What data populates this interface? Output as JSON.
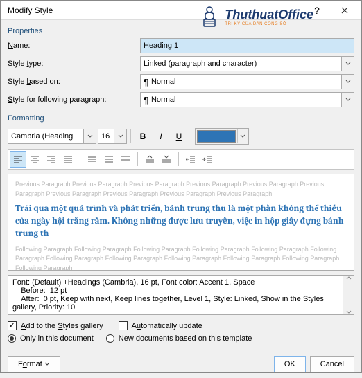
{
  "dialog": {
    "title": "Modify Style"
  },
  "sections": {
    "properties": "Properties",
    "formatting": "Formatting"
  },
  "props": {
    "name_label": "Name:",
    "name_value": "Heading 1",
    "type_label": "Style type:",
    "type_value": "Linked (paragraph and character)",
    "based_label": "Style based on:",
    "based_value": "Normal",
    "follow_label": "Style for following paragraph:",
    "follow_value": "Normal"
  },
  "font": {
    "family": "Cambria (Heading",
    "size": "16"
  },
  "preview": {
    "ghost_before": "Previous Paragraph Previous Paragraph Previous Paragraph Previous Paragraph Previous Paragraph Previous Paragraph Previous Paragraph Previous Paragraph Previous Paragraph Previous Paragraph",
    "sample": "Trải qua một quá trình và phát triển, bánh trung thu là một phần không thể thiếu của ngày hội trăng rằm. Không những được lưu truyền, việc in hộp giấy đựng bánh trung th",
    "ghost_after": "Following Paragraph Following Paragraph Following Paragraph Following Paragraph Following Paragraph Following Paragraph Following Paragraph Following Paragraph Following Paragraph Following Paragraph Following Paragraph Following Paragraph"
  },
  "desc": {
    "line1": "Font: (Default) +Headings (Cambria), 16 pt, Font color: Accent 1, Space",
    "line2": "    Before:  12 pt",
    "line3": "    After:  0 pt, Keep with next, Keep lines together, Level 1, Style: Linked, Show in the Styles gallery, Priority: 10"
  },
  "options": {
    "add_gallery": "Add to the Styles gallery",
    "auto_update": "Automatically update",
    "only_doc": "Only in this document",
    "new_docs": "New documents based on this template"
  },
  "buttons": {
    "format": "Format",
    "ok": "OK",
    "cancel": "Cancel"
  },
  "logo": {
    "brand": "ThuthuatOffice",
    "tag": "TRI KỶ CỦA DÂN CÔNG SỞ"
  },
  "colors": {
    "accent": "#2e74b5"
  }
}
